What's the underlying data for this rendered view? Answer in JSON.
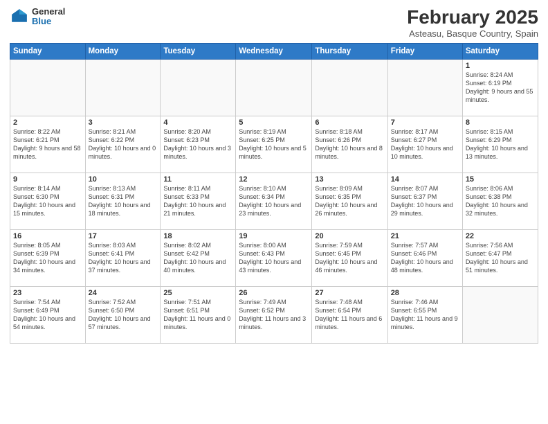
{
  "header": {
    "logo_general": "General",
    "logo_blue": "Blue",
    "month_year": "February 2025",
    "location": "Asteasu, Basque Country, Spain"
  },
  "weekdays": [
    "Sunday",
    "Monday",
    "Tuesday",
    "Wednesday",
    "Thursday",
    "Friday",
    "Saturday"
  ],
  "weeks": [
    [
      {
        "day": "",
        "info": ""
      },
      {
        "day": "",
        "info": ""
      },
      {
        "day": "",
        "info": ""
      },
      {
        "day": "",
        "info": ""
      },
      {
        "day": "",
        "info": ""
      },
      {
        "day": "",
        "info": ""
      },
      {
        "day": "1",
        "info": "Sunrise: 8:24 AM\nSunset: 6:19 PM\nDaylight: 9 hours and 55 minutes."
      }
    ],
    [
      {
        "day": "2",
        "info": "Sunrise: 8:22 AM\nSunset: 6:21 PM\nDaylight: 9 hours and 58 minutes."
      },
      {
        "day": "3",
        "info": "Sunrise: 8:21 AM\nSunset: 6:22 PM\nDaylight: 10 hours and 0 minutes."
      },
      {
        "day": "4",
        "info": "Sunrise: 8:20 AM\nSunset: 6:23 PM\nDaylight: 10 hours and 3 minutes."
      },
      {
        "day": "5",
        "info": "Sunrise: 8:19 AM\nSunset: 6:25 PM\nDaylight: 10 hours and 5 minutes."
      },
      {
        "day": "6",
        "info": "Sunrise: 8:18 AM\nSunset: 6:26 PM\nDaylight: 10 hours and 8 minutes."
      },
      {
        "day": "7",
        "info": "Sunrise: 8:17 AM\nSunset: 6:27 PM\nDaylight: 10 hours and 10 minutes."
      },
      {
        "day": "8",
        "info": "Sunrise: 8:15 AM\nSunset: 6:29 PM\nDaylight: 10 hours and 13 minutes."
      }
    ],
    [
      {
        "day": "9",
        "info": "Sunrise: 8:14 AM\nSunset: 6:30 PM\nDaylight: 10 hours and 15 minutes."
      },
      {
        "day": "10",
        "info": "Sunrise: 8:13 AM\nSunset: 6:31 PM\nDaylight: 10 hours and 18 minutes."
      },
      {
        "day": "11",
        "info": "Sunrise: 8:11 AM\nSunset: 6:33 PM\nDaylight: 10 hours and 21 minutes."
      },
      {
        "day": "12",
        "info": "Sunrise: 8:10 AM\nSunset: 6:34 PM\nDaylight: 10 hours and 23 minutes."
      },
      {
        "day": "13",
        "info": "Sunrise: 8:09 AM\nSunset: 6:35 PM\nDaylight: 10 hours and 26 minutes."
      },
      {
        "day": "14",
        "info": "Sunrise: 8:07 AM\nSunset: 6:37 PM\nDaylight: 10 hours and 29 minutes."
      },
      {
        "day": "15",
        "info": "Sunrise: 8:06 AM\nSunset: 6:38 PM\nDaylight: 10 hours and 32 minutes."
      }
    ],
    [
      {
        "day": "16",
        "info": "Sunrise: 8:05 AM\nSunset: 6:39 PM\nDaylight: 10 hours and 34 minutes."
      },
      {
        "day": "17",
        "info": "Sunrise: 8:03 AM\nSunset: 6:41 PM\nDaylight: 10 hours and 37 minutes."
      },
      {
        "day": "18",
        "info": "Sunrise: 8:02 AM\nSunset: 6:42 PM\nDaylight: 10 hours and 40 minutes."
      },
      {
        "day": "19",
        "info": "Sunrise: 8:00 AM\nSunset: 6:43 PM\nDaylight: 10 hours and 43 minutes."
      },
      {
        "day": "20",
        "info": "Sunrise: 7:59 AM\nSunset: 6:45 PM\nDaylight: 10 hours and 46 minutes."
      },
      {
        "day": "21",
        "info": "Sunrise: 7:57 AM\nSunset: 6:46 PM\nDaylight: 10 hours and 48 minutes."
      },
      {
        "day": "22",
        "info": "Sunrise: 7:56 AM\nSunset: 6:47 PM\nDaylight: 10 hours and 51 minutes."
      }
    ],
    [
      {
        "day": "23",
        "info": "Sunrise: 7:54 AM\nSunset: 6:49 PM\nDaylight: 10 hours and 54 minutes."
      },
      {
        "day": "24",
        "info": "Sunrise: 7:52 AM\nSunset: 6:50 PM\nDaylight: 10 hours and 57 minutes."
      },
      {
        "day": "25",
        "info": "Sunrise: 7:51 AM\nSunset: 6:51 PM\nDaylight: 11 hours and 0 minutes."
      },
      {
        "day": "26",
        "info": "Sunrise: 7:49 AM\nSunset: 6:52 PM\nDaylight: 11 hours and 3 minutes."
      },
      {
        "day": "27",
        "info": "Sunrise: 7:48 AM\nSunset: 6:54 PM\nDaylight: 11 hours and 6 minutes."
      },
      {
        "day": "28",
        "info": "Sunrise: 7:46 AM\nSunset: 6:55 PM\nDaylight: 11 hours and 9 minutes."
      },
      {
        "day": "",
        "info": ""
      }
    ]
  ]
}
